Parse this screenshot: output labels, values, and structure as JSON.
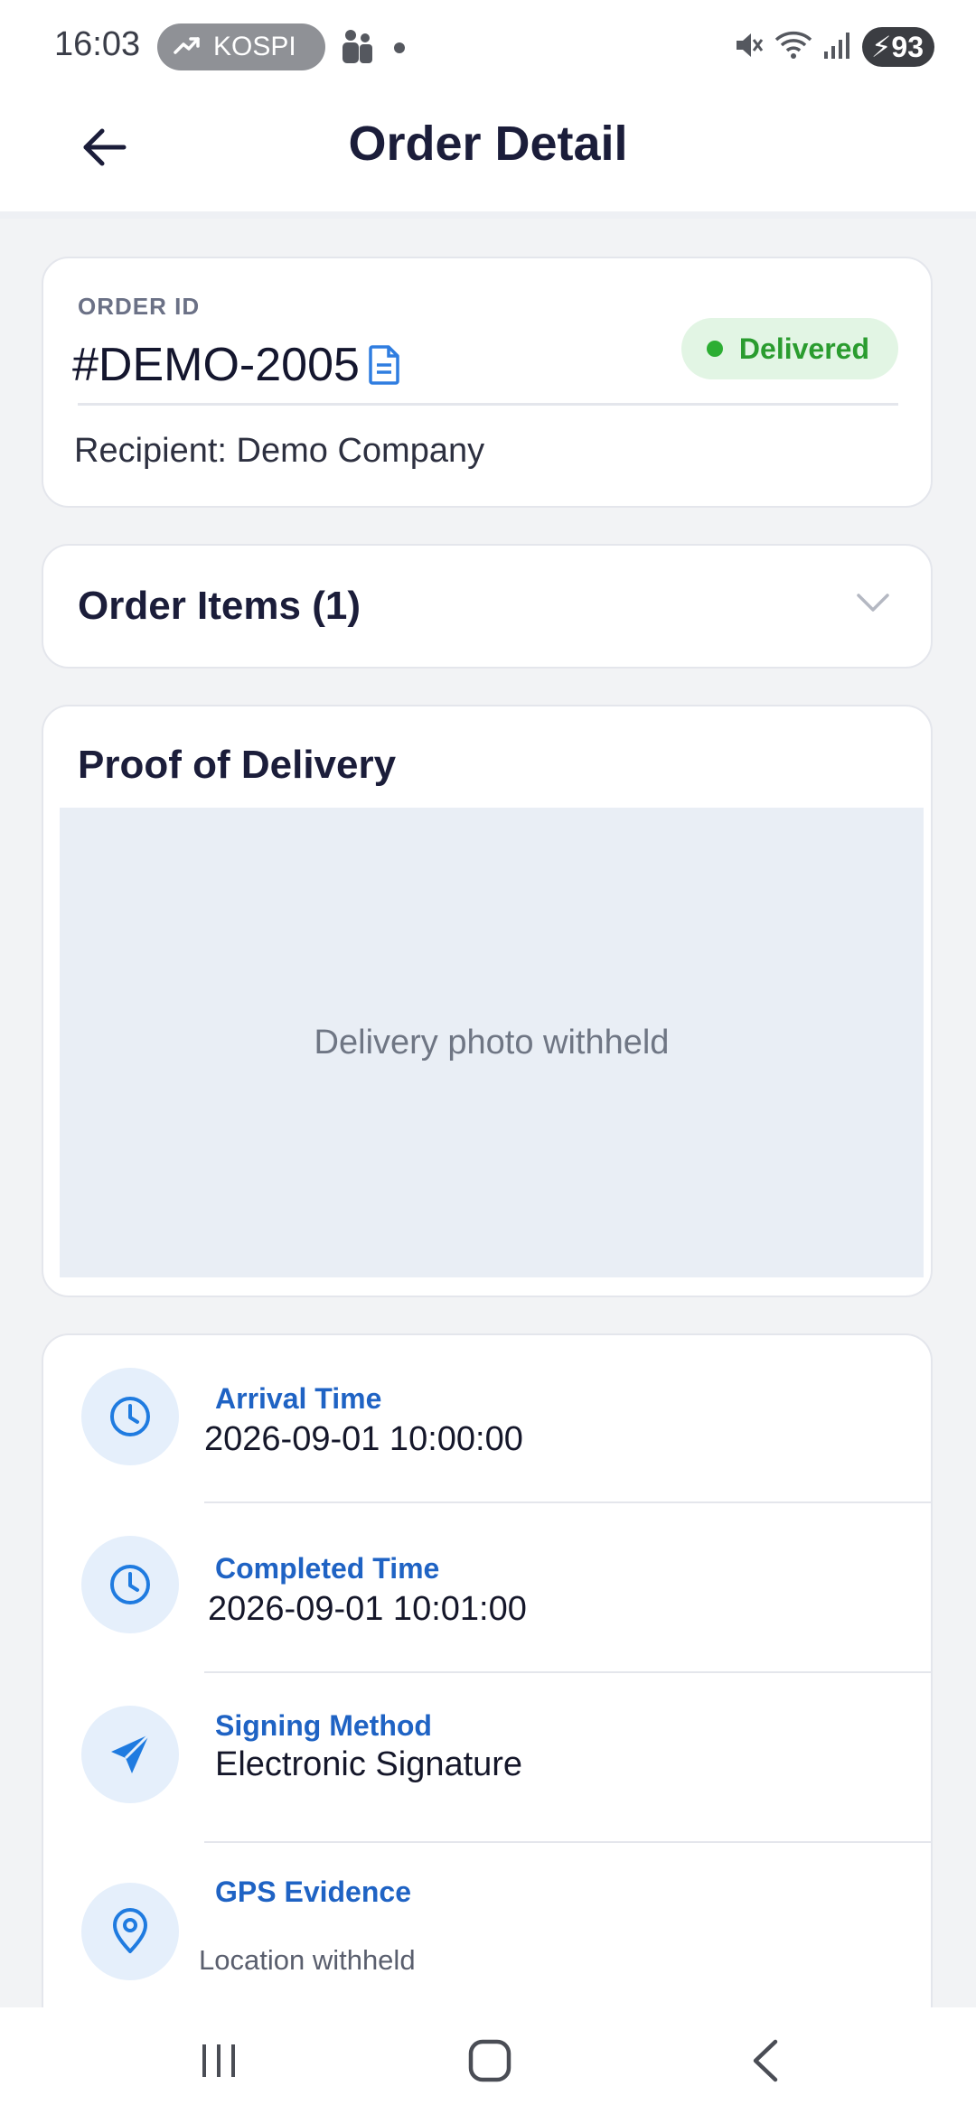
{
  "status_bar": {
    "time": "16:03",
    "ticker_label": "KOSPI",
    "battery": "93",
    "icons": [
      "trending-up-icon",
      "people-icon",
      "mute-icon",
      "wifi-icon",
      "signal-icon",
      "charging-icon"
    ]
  },
  "header": {
    "title": "Order Detail",
    "back_icon": "arrow-left-icon"
  },
  "order": {
    "label": "ORDER ID",
    "id": "#DEMO-2005",
    "status": "Delivered",
    "status_color": "#2a9c2f",
    "recipient": "Recipient: Demo Company"
  },
  "items": {
    "title": "Order Items (1)"
  },
  "proof": {
    "title": "Proof of Delivery",
    "photo_placeholder": "Delivery photo withheld"
  },
  "details": [
    {
      "label": "Arrival Time",
      "value": "2026-09-01 10:00:00",
      "icon": "clock-icon"
    },
    {
      "label": "Completed Time",
      "value": "2026-09-01 10:01:00",
      "icon": "clock-icon"
    },
    {
      "label": "Signing Method",
      "value": "Electronic Signature",
      "icon": "send-icon"
    },
    {
      "label": "GPS Evidence",
      "value": "Location withheld",
      "icon": "location-pin-icon"
    }
  ],
  "accent_color": "#1f63c4"
}
